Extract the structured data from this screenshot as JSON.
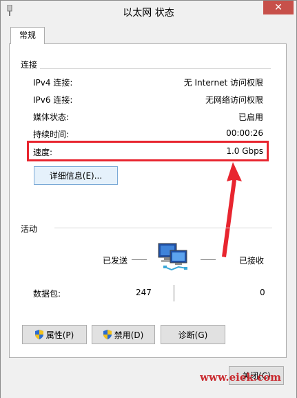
{
  "window": {
    "title": "以太网 状态",
    "close_glyph": "✕"
  },
  "tabs": [
    {
      "label": "常规"
    }
  ],
  "connection": {
    "section_label": "连接",
    "rows": [
      {
        "label": "IPv4 连接:",
        "value": "无 Internet 访问权限"
      },
      {
        "label": "IPv6 连接:",
        "value": "无网络访问权限"
      },
      {
        "label": "媒体状态:",
        "value": "已启用"
      },
      {
        "label": "持续时间:",
        "value": "00:00:26"
      },
      {
        "label": "速度:",
        "value": "1.0 Gbps"
      }
    ],
    "details_button": "详细信息(E)..."
  },
  "activity": {
    "section_label": "活动",
    "sent_label": "已发送",
    "received_label": "已接收",
    "packets_label": "数据包:",
    "packets_sent": "247",
    "packets_received": "0"
  },
  "actions": {
    "properties": "属性(P)",
    "disable": "禁用(D)",
    "diagnose": "诊断(G)"
  },
  "footer": {
    "close_button": "关闭(C)",
    "watermark": "www.eiek.com"
  },
  "icons": {
    "app": "network-adapter-icon",
    "network": "network-computers-icon",
    "shield": "uac-shield-icon"
  },
  "colors": {
    "highlight": "#e8252f",
    "close_hover": "#c7504a",
    "watermark": "#c9282d"
  }
}
